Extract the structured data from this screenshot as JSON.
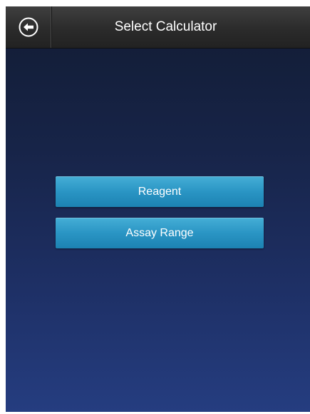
{
  "header": {
    "title": "Select Calculator",
    "back_icon": "back-arrow-circle-icon"
  },
  "menu": {
    "buttons": [
      {
        "label": "Reagent"
      },
      {
        "label": "Assay Range"
      }
    ]
  },
  "colors": {
    "header_background": "#2b2b2b",
    "screen_gradient_top": "#121c33",
    "screen_gradient_bottom": "#253d80",
    "button_accent": "#2a95c4",
    "text": "#ffffff"
  }
}
